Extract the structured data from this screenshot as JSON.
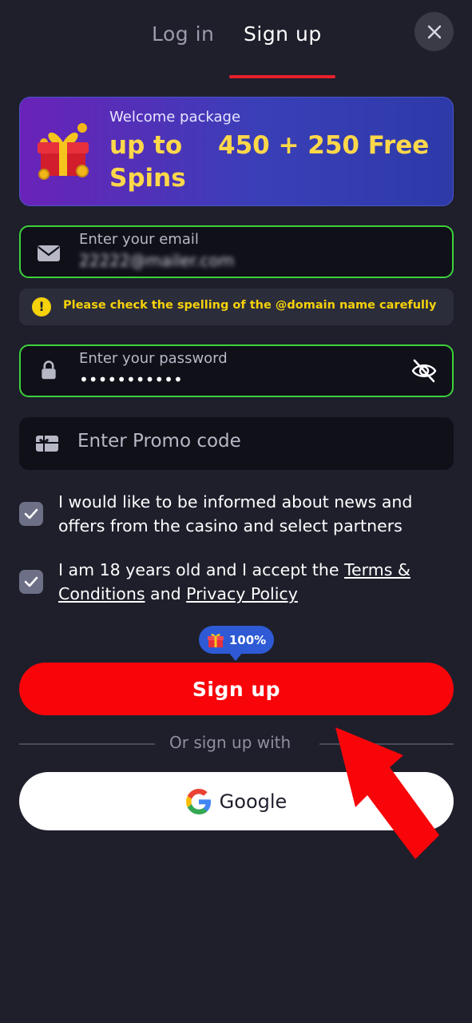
{
  "tabs": {
    "login": "Log in",
    "signup": "Sign up",
    "active": "signup"
  },
  "banner": {
    "subtitle": "Welcome package",
    "line1": "up to",
    "line2": "Spins",
    "amount": "450 + 250 Free"
  },
  "email": {
    "label": "Enter your email",
    "value": "22222@mailer.com"
  },
  "warning": {
    "text": "Please check the spelling of the @domain name carefully"
  },
  "password": {
    "label": "Enter your password",
    "value": "•••••••••••"
  },
  "promo": {
    "placeholder": "Enter Promo code"
  },
  "consents": {
    "news": {
      "line1": "I would like to be informed about news and",
      "line2": "offers from the casino and select partners",
      "checked": true
    },
    "terms": {
      "prefix": "I am 18 years old and I accept the ",
      "terms_link": "Terms &",
      "conditions_link": "Conditions",
      "and": " and ",
      "privacy_link": "Privacy Policy",
      "checked": true
    }
  },
  "bonus_badge": {
    "text": "100%"
  },
  "signup_button": {
    "label": "Sign up"
  },
  "divider": {
    "text": "Or sign up with"
  },
  "google_button": {
    "label": "Google"
  },
  "colors": {
    "background": "#1e1f2b",
    "primary": "#f8050a",
    "valid": "#3ed13b",
    "warning": "#f5d20a",
    "accent": "#ffd84a",
    "badge": "#2e5ad6"
  }
}
